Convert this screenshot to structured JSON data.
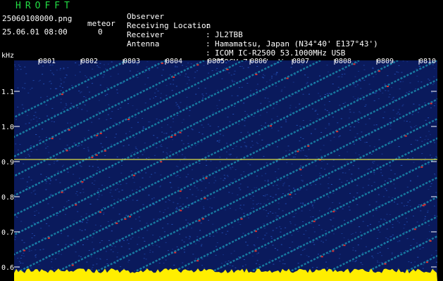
{
  "header": {
    "app_title": "HROFFT",
    "filename": "25060108000.png",
    "datetime": "25.06.01 08:00",
    "meteor_label": "meteor",
    "meteor_count": "0"
  },
  "info": [
    {
      "key": "Observer",
      "value": "JL2TBB"
    },
    {
      "key": "Receiving Location",
      "value": "Hamamatsu, Japan (N34°40' E137°43')"
    },
    {
      "key": "Receiver",
      "value": "ICOM IC-R2500 53.1000MHz USB"
    },
    {
      "key": "Antenna",
      "value": "HB9CV Zenith dir."
    }
  ],
  "plot": {
    "y_unit": "kHz",
    "y_ticks": [
      "1.1",
      "1.0",
      "0.9",
      "0.8",
      "0.7",
      "0.6"
    ],
    "x_ticks": [
      "0801",
      "0802",
      "0803",
      "0804",
      "0805",
      "0806",
      "0807",
      "0808",
      "0809",
      "0810"
    ],
    "colors": {
      "background": "#0a1a5c",
      "noise": "#2b5fd0",
      "trace": "#22c8d8",
      "peak": "#e03030",
      "level": "#ffee00",
      "carrier": "#dddd44"
    }
  }
}
